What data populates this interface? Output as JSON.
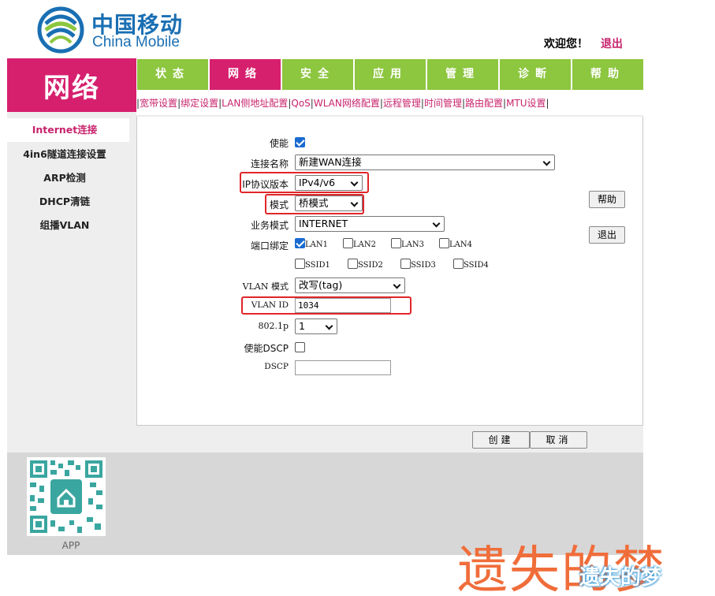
{
  "brand": {
    "name_cn": "中国移动",
    "name_en": "China Mobile"
  },
  "header": {
    "welcome": "欢迎您！",
    "logout": "退出"
  },
  "section_title": "网络",
  "tabs": [
    {
      "label": "状态",
      "active": false
    },
    {
      "label": "网络",
      "active": true
    },
    {
      "label": "安全",
      "active": false
    },
    {
      "label": "应用",
      "active": false
    },
    {
      "label": "管理",
      "active": false
    },
    {
      "label": "诊断",
      "active": false
    },
    {
      "label": "帮助",
      "active": false
    }
  ],
  "subnav": [
    "宽带设置",
    "绑定设置",
    "LAN侧地址配置",
    "QoS",
    "WLAN网络配置",
    "远程管理",
    "时间管理",
    "路由配置",
    "MTU设置"
  ],
  "sidebar": [
    {
      "label": "Internet连接",
      "active": true
    },
    {
      "label": "4in6隧道连接设置",
      "active": false
    },
    {
      "label": "ARP检测",
      "active": false
    },
    {
      "label": "DHCP清链",
      "active": false
    },
    {
      "label": "组播VLAN",
      "active": false
    }
  ],
  "form": {
    "enable": {
      "label": "使能",
      "checked": true
    },
    "connection_name": {
      "label": "连接名称",
      "value": "新建WAN连接"
    },
    "ip_version": {
      "label": "IP协议版本",
      "value": "IPv4/v6"
    },
    "mode": {
      "label": "模式",
      "value": "桥模式"
    },
    "service_mode": {
      "label": "业务模式",
      "value": "INTERNET"
    },
    "port_binding": {
      "label": "端口绑定",
      "ports": [
        {
          "name": "LAN1",
          "checked": true
        },
        {
          "name": "LAN2",
          "checked": false
        },
        {
          "name": "LAN3",
          "checked": false
        },
        {
          "name": "LAN4",
          "checked": false
        },
        {
          "name": "SSID1",
          "checked": false
        },
        {
          "name": "SSID2",
          "checked": false
        },
        {
          "name": "SSID3",
          "checked": false
        },
        {
          "name": "SSID4",
          "checked": false
        }
      ]
    },
    "vlan_mode": {
      "label": "VLAN 模式",
      "value": "改写(tag)"
    },
    "vlan_id": {
      "label": "VLAN ID",
      "value": "1034"
    },
    "dot1p": {
      "label": "802.1p",
      "value": "1"
    },
    "enable_dscp": {
      "label": "使能DSCP",
      "checked": false
    },
    "dscp": {
      "label": "DSCP",
      "value": ""
    }
  },
  "side_buttons": {
    "help": "帮助",
    "exit": "退出"
  },
  "actions": {
    "create": "创建",
    "cancel": "取消"
  },
  "footer": {
    "app_label": "APP"
  },
  "watermark": {
    "big": "遗失的梦",
    "small": "遗失的梦"
  },
  "colors": {
    "brand_pink": "#d6206e",
    "tab_green": "#8dc63f",
    "brand_blue": "#1a6fb3",
    "highlight_red": "#e0262a"
  }
}
